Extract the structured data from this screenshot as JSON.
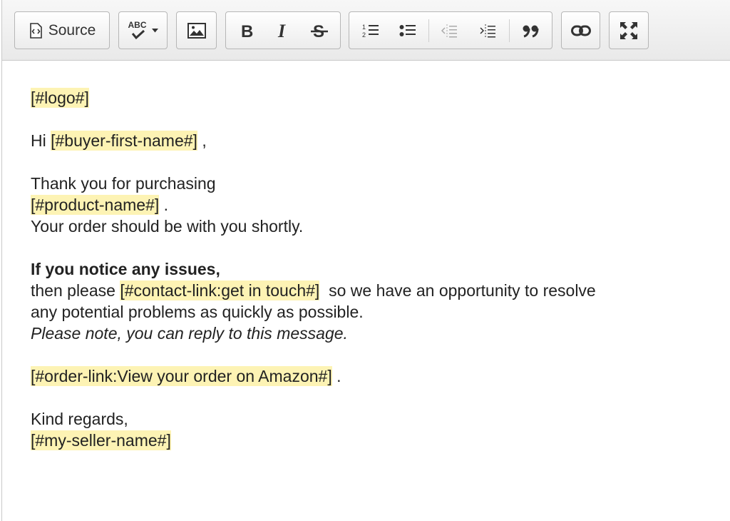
{
  "toolbar": {
    "source_label": "Source",
    "spellcheck_label": "ABC",
    "icons": [
      "source-icon",
      "spellcheck-icon",
      "image-icon",
      "bold-icon",
      "italic-icon",
      "strikethrough-icon",
      "numbered-list-icon",
      "bulleted-list-icon",
      "outdent-icon",
      "indent-icon",
      "blockquote-icon",
      "link-icon",
      "maximize-icon"
    ]
  },
  "body": {
    "logo": "[#logo#]",
    "greeting_prefix": "Hi ",
    "buyer_first_name": "[#buyer-first-name#]",
    "greeting_suffix": " ,",
    "thanks_line": "Thank you for purchasing",
    "product_name": "[#product-name#]",
    "product_suffix": " .",
    "order_line": "Your order should be with you shortly.",
    "issues_heading": "If you notice any issues,",
    "contact_prefix": "then please ",
    "contact_link": "[#contact-link:get in touch#]",
    "contact_suffix": "  so we have an opportunity to resolve",
    "contact_line2": "any potential problems as quickly as possible.",
    "note_line": "Please note, you can reply to this message.",
    "order_link": "[#order-link:View your order on Amazon#]",
    "order_link_suffix": " .",
    "regards": "Kind regards,",
    "seller_name": "[#my-seller-name#]"
  },
  "colors": {
    "placeholder_highlight": "#fdf3b4",
    "text": "#222222"
  }
}
